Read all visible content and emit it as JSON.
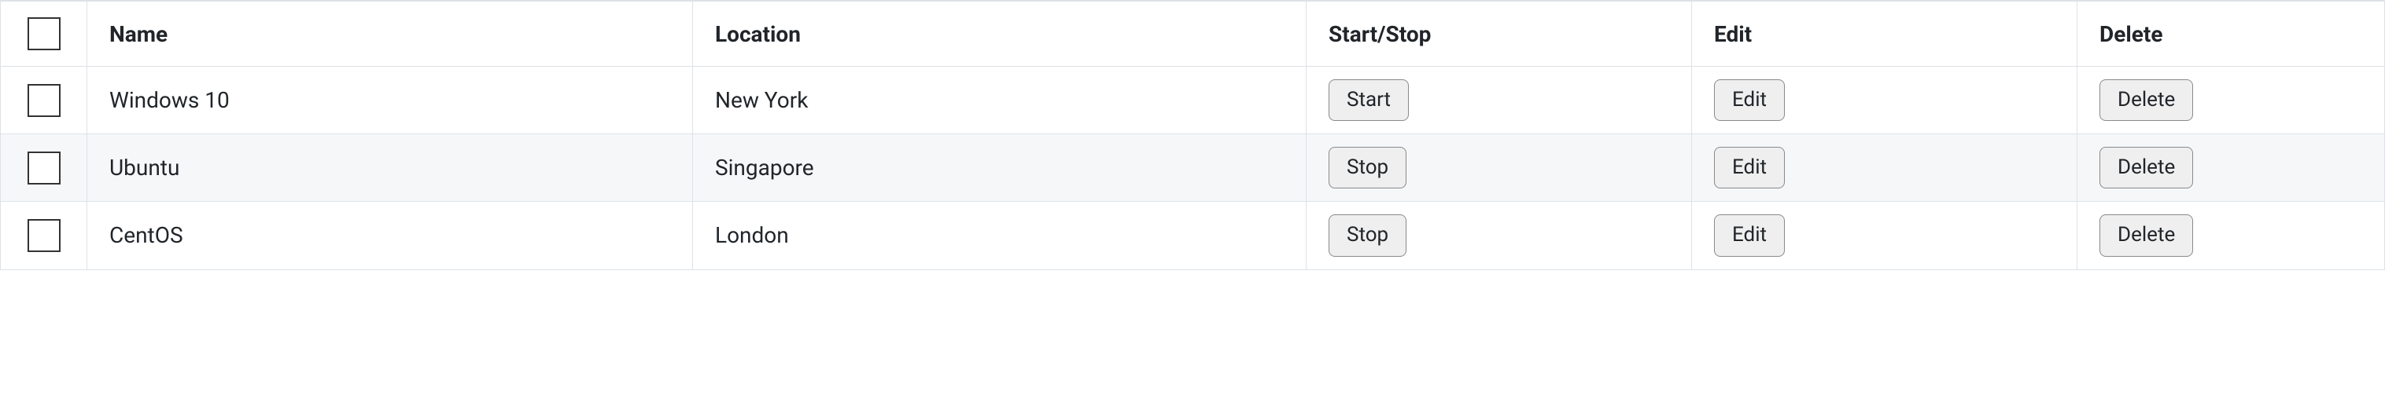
{
  "headers": {
    "name": "Name",
    "location": "Location",
    "startstop": "Start/Stop",
    "edit": "Edit",
    "delete": "Delete"
  },
  "rows": [
    {
      "name": "Windows 10",
      "location": "New York",
      "ss_label": "Start",
      "edit_label": "Edit",
      "delete_label": "Delete"
    },
    {
      "name": "Ubuntu",
      "location": "Singapore",
      "ss_label": "Stop",
      "edit_label": "Edit",
      "delete_label": "Delete"
    },
    {
      "name": "CentOS",
      "location": "London",
      "ss_label": "Stop",
      "edit_label": "Edit",
      "delete_label": "Delete"
    }
  ]
}
